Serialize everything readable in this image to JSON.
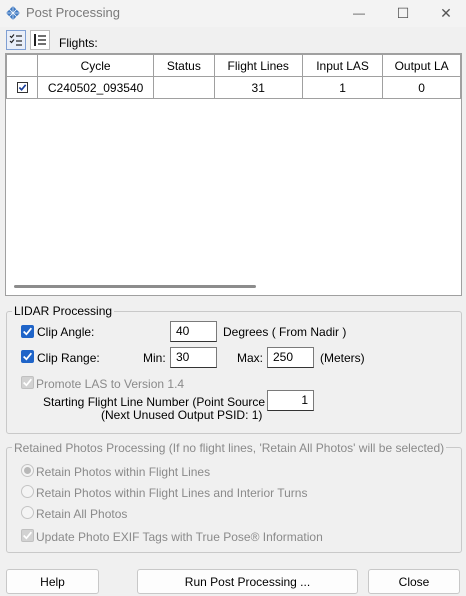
{
  "window": {
    "title": "Post Processing",
    "minimize_glyph": "—",
    "maximize_glyph": "☐",
    "close_glyph": "✕"
  },
  "toolbar": {
    "flights_label": "Flights:"
  },
  "table": {
    "columns": [
      "",
      "Cycle",
      "Status",
      "Flight Lines",
      "Input LAS",
      "Output LA"
    ],
    "rows": [
      {
        "checked": true,
        "cycle": "C240502_093540",
        "status": "",
        "flight_lines": "31",
        "input_las": "1",
        "output_las": "0"
      }
    ]
  },
  "lidar": {
    "legend": "LIDAR Processing",
    "clip_angle_label": "Clip Angle:",
    "clip_angle_value": "40",
    "clip_angle_unit": "Degrees ( From Nadir )",
    "clip_range_label": "Clip Range:",
    "min_label": "Min:",
    "min_value": "30",
    "max_label": "Max:",
    "max_value": "250",
    "range_unit": "(Meters)",
    "promote_label": "Promote LAS to Version 1.4",
    "start_line_label": "Starting Flight Line Number (Point Source ID):",
    "start_line_value": "1",
    "next_psid_label": "(Next Unused Output PSID: 1)"
  },
  "photos": {
    "legend": "Retained Photos Processing  (If no flight lines, 'Retain All Photos' will be selected)",
    "option_within": "Retain Photos within Flight Lines",
    "option_turns": "Retain Photos within Flight Lines and Interior Turns",
    "option_all": "Retain All Photos",
    "update_exif": "Update Photo EXIF Tags with True Pose® Information"
  },
  "buttons": {
    "help": "Help",
    "run": "Run Post Processing ...",
    "close": "Close"
  },
  "colors": {
    "accent": "#1f64c8",
    "disabled_text": "#8a8a8a"
  }
}
